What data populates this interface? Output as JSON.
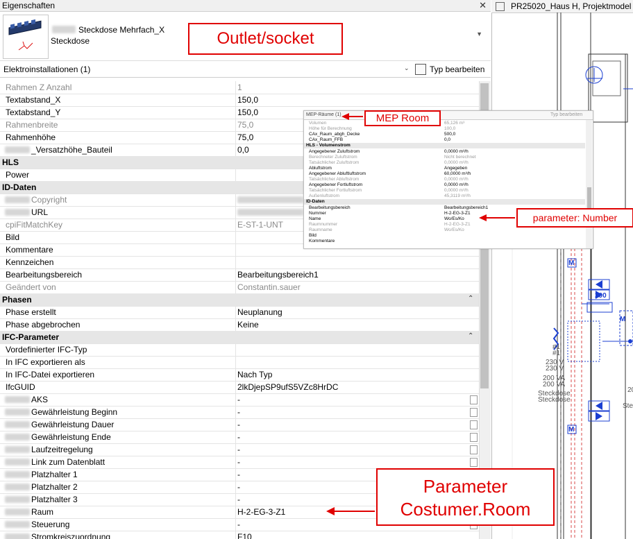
{
  "panel": {
    "title": "Eigenschaften",
    "close": "✕",
    "type_name": "Steckdose Mehrfach_X",
    "type_family": "Steckdose",
    "filter_label": "Elektroinstallationen (1)",
    "edit_type_label": "Typ bearbeiten"
  },
  "rows": [
    {
      "name": "Rahmen Z Anzahl",
      "value": "1",
      "kind": "gray"
    },
    {
      "name": "Textabstand_X",
      "value": "150,0",
      "kind": "normal"
    },
    {
      "name": "Textabstand_Y",
      "value": "150,0",
      "kind": "normal"
    },
    {
      "name": "Rahmenbreite",
      "value": "75,0",
      "kind": "gray"
    },
    {
      "name": "Rahmenhöhe",
      "value": "75,0",
      "kind": "normal"
    },
    {
      "name": "_Versatzhöhe_Bauteil",
      "value": "0,0",
      "kind": "normal",
      "blurred_prefix": true
    },
    {
      "name": "HLS",
      "value": "",
      "kind": "group"
    },
    {
      "name": "Power",
      "value": "",
      "kind": "normal"
    },
    {
      "name": "ID-Daten",
      "value": "",
      "kind": "group"
    },
    {
      "name": "Copyright",
      "value": "",
      "kind": "gray",
      "blurred_prefix": true,
      "blurred_value": true
    },
    {
      "name": "URL",
      "value": "",
      "kind": "normal",
      "blurred_prefix": true,
      "blurred_value": true
    },
    {
      "name": "cpiFitMatchKey",
      "value": "E-ST-1-UNT",
      "kind": "gray"
    },
    {
      "name": "Bild",
      "value": "",
      "kind": "normal"
    },
    {
      "name": "Kommentare",
      "value": "",
      "kind": "normal"
    },
    {
      "name": "Kennzeichen",
      "value": "",
      "kind": "normal"
    },
    {
      "name": "Bearbeitungsbereich",
      "value": "Bearbeitungsbereich1",
      "kind": "normal"
    },
    {
      "name": "Geändert von",
      "value": "Constantin.sauer",
      "kind": "gray"
    },
    {
      "name": "Phasen",
      "value": "",
      "kind": "group",
      "collapse": "⌃"
    },
    {
      "name": "Phase erstellt",
      "value": "Neuplanung",
      "kind": "normal"
    },
    {
      "name": "Phase abgebrochen",
      "value": "Keine",
      "kind": "normal"
    },
    {
      "name": "IFC-Parameter",
      "value": "",
      "kind": "group",
      "collapse": "⌃"
    },
    {
      "name": "Vordefinierter IFC-Typ",
      "value": "",
      "kind": "normal"
    },
    {
      "name": "In IFC exportieren als",
      "value": "",
      "kind": "normal"
    },
    {
      "name": "In IFC-Datei exportieren",
      "value": "Nach Typ",
      "kind": "normal"
    },
    {
      "name": "IfcGUID",
      "value": "2lkDjepSP9ufS5VZc8HrDC",
      "kind": "normal"
    },
    {
      "name": "AKS",
      "value": "-",
      "kind": "normal",
      "blurred_prefix": true,
      "checkbox": true
    },
    {
      "name": "Gewährleistung Beginn",
      "value": "-",
      "kind": "normal",
      "blurred_prefix": true,
      "checkbox": true
    },
    {
      "name": "Gewährleistung Dauer",
      "value": "-",
      "kind": "normal",
      "blurred_prefix": true,
      "checkbox": true
    },
    {
      "name": "Gewährleistung Ende",
      "value": "-",
      "kind": "normal",
      "blurred_prefix": true,
      "checkbox": true
    },
    {
      "name": "Laufzeitregelung",
      "value": "-",
      "kind": "normal",
      "blurred_prefix": true,
      "checkbox": true
    },
    {
      "name": "Link zum Datenblatt",
      "value": "-",
      "kind": "normal",
      "blurred_prefix": true,
      "checkbox": true
    },
    {
      "name": "Platzhalter 1",
      "value": "-",
      "kind": "normal",
      "blurred_prefix": true,
      "checkbox": true
    },
    {
      "name": "Platzhalter 2",
      "value": "-",
      "kind": "normal",
      "blurred_prefix": true,
      "checkbox": true
    },
    {
      "name": "Platzhalter 3",
      "value": "-",
      "kind": "normal",
      "blurred_prefix": true,
      "checkbox": true
    },
    {
      "name": "Raum",
      "value": "H-2-EG-3-Z1",
      "kind": "normal",
      "blurred_prefix": true,
      "checkbox": true
    },
    {
      "name": "Steuerung",
      "value": "-",
      "kind": "normal",
      "blurred_prefix": true,
      "checkbox": true
    },
    {
      "name": "Stromkreiszuordnung",
      "value": "F10",
      "kind": "normal",
      "blurred_prefix": true
    }
  ],
  "view": {
    "title": "PR25020_Haus H, Projektmodel",
    "labels": [
      "290",
      "#1",
      "#1",
      "230 V",
      "230 V",
      "200 VA",
      "200 VA",
      "Steckdose",
      "Steckdose",
      "20",
      "Ste",
      "M",
      "M",
      "M"
    ]
  },
  "mep": {
    "title": "MEP-Räume (1)",
    "edit_label": "Typ bearbeiten",
    "rows": [
      {
        "name": "Volumen",
        "value": "65,126 m³",
        "kind": "gray"
      },
      {
        "name": "Höhe für Berechnung",
        "value": "100,0",
        "kind": "gray"
      },
      {
        "name": "CAx_Raum_abgh_Decke",
        "value": "500,0",
        "kind": "normal"
      },
      {
        "name": "CAx_Raum_FFB",
        "value": "0,0",
        "kind": "normal"
      },
      {
        "name": "HLS - Volumenstrom",
        "value": "",
        "kind": "group"
      },
      {
        "name": "Angegebener Zuluftstrom",
        "value": "0,0000 m³/h",
        "kind": "normal"
      },
      {
        "name": "Berechneter Zuluftstrom",
        "value": "Nicht berechnet",
        "kind": "gray"
      },
      {
        "name": "Tatsächlicher Zuluftstrom",
        "value": "0,0000 m³/h",
        "kind": "gray"
      },
      {
        "name": "Abluftstrom",
        "value": "Angegeben",
        "kind": "normal"
      },
      {
        "name": "Angegebener Abluftluftstrom",
        "value": "60,0000 m³/h",
        "kind": "normal"
      },
      {
        "name": "Tatsächlicher Abluftstrom",
        "value": "0,0000 m³/h",
        "kind": "gray"
      },
      {
        "name": "Angegebener Fortluftstrom",
        "value": "0,0000 m³/h",
        "kind": "normal"
      },
      {
        "name": "Tatsächlicher Fortluftstrom",
        "value": "0,0000 m³/h",
        "kind": "gray"
      },
      {
        "name": "Außenluftstrom",
        "value": "45,3119 m³/h",
        "kind": "gray"
      },
      {
        "name": "ID-Daten",
        "value": "",
        "kind": "group"
      },
      {
        "name": "Bearbeitungsbereich",
        "value": "Bearbeitungsbereich1",
        "kind": "normal"
      },
      {
        "name": "Nummer",
        "value": "H-2-EG-3-Z1",
        "kind": "normal"
      },
      {
        "name": "Name",
        "value": "Wo/Es/Ko",
        "kind": "normal"
      },
      {
        "name": "Raumnummer",
        "value": "H-2-EG-3-Z1",
        "kind": "gray"
      },
      {
        "name": "Raumname",
        "value": "Wo/Es/Ko",
        "kind": "gray"
      },
      {
        "name": "Bild",
        "value": "",
        "kind": "normal"
      },
      {
        "name": "Kommentare",
        "value": "",
        "kind": "normal"
      }
    ]
  },
  "callouts": {
    "outlet": "Outlet/socket",
    "mep": "MEP Room",
    "number": "parameter: Number",
    "param_line1": "Parameter",
    "param_line2": "Costumer.Room"
  },
  "colors": {
    "callout_red": "#e00000",
    "revit_blue": "#1b3fd1"
  }
}
